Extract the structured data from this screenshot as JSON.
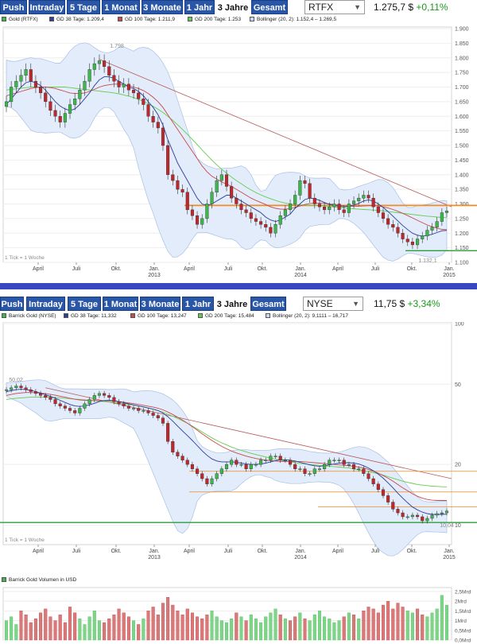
{
  "tabs": [
    "Push",
    "Intraday",
    "5 Tage",
    "1 Monat",
    "3 Monate",
    "1 Jahr",
    "3 Jahre",
    "Gesamt"
  ],
  "colors": {
    "up": "#3cb84a",
    "down": "#c0262c",
    "gd38": "#2c3e9e",
    "gd100": "#c94a4a",
    "gd200": "#66cc4f",
    "bollinger": "#c9d8f2",
    "orange": "#f08a24",
    "green": "#2e9e3e",
    "tab": "#2a56a8",
    "divider": "#3848c0"
  },
  "footer": "1 Tick = 1 Woche",
  "xaxis": {
    "months": [
      "April",
      "Juli",
      "Okt.",
      "Jan.",
      "April",
      "Juli",
      "Okt.",
      "Jan.",
      "April",
      "Juli",
      "Okt.",
      "Jan."
    ],
    "years": [
      "2013",
      "2014",
      "2015"
    ]
  },
  "gold": {
    "symbol": "RTFX",
    "price": "1.275,7 $",
    "change": "+0,11%",
    "legend": [
      "Gold (RTFX)",
      "GD 38 Tage: 1.209,4",
      "GD 100 Tage: 1.211,9",
      "GD 200 Tage: 1.253",
      "Bollinger (20, 2): 1.152,4 – 1.269,5"
    ],
    "high_label": "1.798",
    "low_label": "1.132,1",
    "chart_data": {
      "type": "candlestick",
      "ylim": [
        1100,
        1900
      ],
      "yticks": [
        "1.900",
        "1.850",
        "1.800",
        "1.750",
        "1.700",
        "1.650",
        "1.600",
        "1.550",
        "1.500",
        "1.450",
        "1.400",
        "1.350",
        "1.300",
        "1.250",
        "1.200",
        "1.150",
        "1.100"
      ],
      "series": [
        {
          "name": "Gold (RTFX)",
          "close": [
            1650,
            1700,
            1720,
            1740,
            1760,
            1720,
            1700,
            1680,
            1650,
            1620,
            1600,
            1580,
            1610,
            1640,
            1660,
            1690,
            1720,
            1760,
            1780,
            1790,
            1770,
            1740,
            1720,
            1700,
            1710,
            1690,
            1680,
            1660,
            1640,
            1600,
            1580,
            1560,
            1500,
            1400,
            1380,
            1350,
            1340,
            1280,
            1260,
            1230,
            1250,
            1300,
            1340,
            1380,
            1400,
            1360,
            1320,
            1300,
            1280,
            1270,
            1250,
            1240,
            1230,
            1220,
            1200,
            1230,
            1260,
            1280,
            1300,
            1330,
            1380,
            1370,
            1320,
            1300,
            1290,
            1280,
            1290,
            1300,
            1280,
            1270,
            1300,
            1310,
            1320,
            1330,
            1320,
            1290,
            1270,
            1250,
            1230,
            1220,
            1200,
            1180,
            1170,
            1160,
            1180,
            1190,
            1210,
            1220,
            1240,
            1270,
            1276
          ]
        }
      ]
    },
    "gd38": [
      1640,
      1660,
      1680,
      1700,
      1715,
      1720,
      1715,
      1705,
      1690,
      1670,
      1650,
      1635,
      1625,
      1620,
      1625,
      1640,
      1660,
      1680,
      1705,
      1725,
      1735,
      1735,
      1730,
      1720,
      1710,
      1700,
      1695,
      1685,
      1670,
      1650,
      1630,
      1605,
      1570,
      1520,
      1480,
      1440,
      1410,
      1380,
      1350,
      1320,
      1300,
      1295,
      1300,
      1310,
      1320,
      1330,
      1330,
      1320,
      1310,
      1300,
      1290,
      1280,
      1270,
      1255,
      1245,
      1240,
      1245,
      1255,
      1265,
      1285,
      1300,
      1315,
      1320,
      1318,
      1312,
      1305,
      1298,
      1295,
      1292,
      1290,
      1292,
      1296,
      1302,
      1310,
      1314,
      1310,
      1300,
      1288,
      1274,
      1258,
      1242,
      1226,
      1212,
      1200,
      1193,
      1190,
      1192,
      1196,
      1202,
      1208,
      1209.4
    ],
    "gd100": [
      1670,
      1675,
      1680,
      1685,
      1690,
      1695,
      1698,
      1700,
      1700,
      1698,
      1695,
      1690,
      1685,
      1680,
      1678,
      1678,
      1680,
      1685,
      1692,
      1700,
      1705,
      1708,
      1710,
      1710,
      1708,
      1705,
      1700,
      1695,
      1688,
      1678,
      1665,
      1650,
      1630,
      1605,
      1580,
      1555,
      1530,
      1505,
      1480,
      1455,
      1430,
      1410,
      1395,
      1385,
      1375,
      1368,
      1360,
      1350,
      1340,
      1330,
      1320,
      1312,
      1305,
      1298,
      1290,
      1285,
      1282,
      1282,
      1284,
      1288,
      1293,
      1298,
      1301,
      1303,
      1303,
      1302,
      1300,
      1298,
      1295,
      1293,
      1292,
      1292,
      1292,
      1293,
      1294,
      1294,
      1293,
      1290,
      1286,
      1281,
      1275,
      1268,
      1260,
      1252,
      1244,
      1236,
      1228,
      1222,
      1217,
      1213,
      1211.9
    ],
    "gd200": [
      1690,
      1692,
      1694,
      1696,
      1698,
      1700,
      1700,
      1700,
      1700,
      1700,
      1700,
      1700,
      1700,
      1698,
      1696,
      1694,
      1692,
      1690,
      1688,
      1686,
      1684,
      1682,
      1680,
      1677,
      1673,
      1669,
      1664,
      1658,
      1651,
      1643,
      1634,
      1624,
      1613,
      1600,
      1586,
      1571,
      1555,
      1538,
      1521,
      1503,
      1485,
      1467,
      1450,
      1434,
      1419,
      1405,
      1392,
      1380,
      1369,
      1358,
      1348,
      1339,
      1331,
      1324,
      1318,
      1312,
      1307,
      1303,
      1300,
      1298,
      1297,
      1296,
      1296,
      1295,
      1294,
      1293,
      1292,
      1290,
      1288,
      1286,
      1284,
      1283,
      1282,
      1281,
      1280,
      1279,
      1278,
      1276,
      1274,
      1272,
      1270,
      1268,
      1266,
      1264,
      1262,
      1260,
      1258,
      1257,
      1255,
      1254,
      1253
    ],
    "support_level": 1295,
    "low_level": 1140
  },
  "barrick": {
    "symbol": "NYSE",
    "price": "11,75 $",
    "change": "+3,34%",
    "legend": [
      "Barrick Gold (NYSE)",
      "GD 38 Tage: 11,332",
      "GD 100 Tage: 13,247",
      "GD 200 Tage: 15,484",
      "Bollinger (20, 2): 9,1111 – 16,717"
    ],
    "high_label": "50,02",
    "low_label": "10,04",
    "chart_data": {
      "type": "candlestick",
      "scale": "log",
      "ylim": [
        8,
        100
      ],
      "yticks": [
        "100",
        "50",
        "20",
        "10"
      ],
      "series": [
        {
          "name": "Barrick Gold (NYSE)",
          "close": [
            47,
            48,
            49,
            48,
            47,
            46,
            45,
            44,
            43,
            42,
            40,
            39,
            38,
            37,
            36,
            38,
            40,
            42,
            44,
            45,
            44,
            43,
            41,
            40,
            39,
            38,
            38,
            37,
            37,
            36,
            35,
            34,
            32,
            26,
            23,
            22,
            21,
            20,
            19,
            18,
            17,
            16,
            17,
            18,
            19,
            20,
            21,
            20,
            20,
            19,
            20,
            20,
            21,
            21,
            22,
            22,
            21,
            21,
            20,
            19,
            19,
            18,
            18,
            19,
            19,
            20,
            21,
            21,
            21,
            20,
            20,
            19,
            19,
            18,
            17,
            16,
            15,
            14,
            13,
            12,
            11.5,
            11,
            11,
            11.2,
            11,
            10.5,
            10.8,
            11.2,
            11.4,
            11.5,
            11.75
          ]
        }
      ]
    },
    "gd38": [
      46,
      46.5,
      47,
      47.2,
      47,
      46.6,
      46,
      45.2,
      44.4,
      43.5,
      42.6,
      41.6,
      40.6,
      39.7,
      39,
      38.8,
      39,
      39.5,
      40.2,
      41,
      41.5,
      41.6,
      41.4,
      41,
      40.5,
      40,
      39.5,
      39,
      38.6,
      38.1,
      37.6,
      37,
      36,
      34.5,
      32.8,
      31,
      29.3,
      27.8,
      26.3,
      24.8,
      23.4,
      22.2,
      21.3,
      20.8,
      20.6,
      20.6,
      20.6,
      20.5,
      20.3,
      20.1,
      20,
      20,
      20.1,
      20.3,
      20.6,
      20.9,
      21.1,
      21.1,
      21,
      20.8,
      20.5,
      20.2,
      19.9,
      19.7,
      19.6,
      19.7,
      19.9,
      20.1,
      20.3,
      20.4,
      20.4,
      20.3,
      20.1,
      19.7,
      19.2,
      18.6,
      17.9,
      17.1,
      16.2,
      15.3,
      14.4,
      13.6,
      12.9,
      12.3,
      11.9,
      11.6,
      11.4,
      11.3,
      11.3,
      11.3,
      11.33
    ],
    "gd100": [
      44,
      44.5,
      45,
      45.3,
      45.5,
      45.5,
      45.4,
      45.2,
      44.9,
      44.5,
      44.1,
      43.6,
      43.1,
      42.6,
      42.1,
      41.8,
      41.6,
      41.5,
      41.5,
      41.5,
      41.5,
      41.4,
      41.2,
      41,
      40.7,
      40.4,
      40.1,
      39.7,
      39.3,
      38.9,
      38.5,
      38,
      37.3,
      36.4,
      35.4,
      34.3,
      33.2,
      32,
      30.8,
      29.6,
      28.4,
      27.3,
      26.3,
      25.4,
      24.6,
      23.9,
      23.3,
      22.8,
      22.4,
      22,
      21.7,
      21.4,
      21.2,
      21,
      20.9,
      20.8,
      20.7,
      20.7,
      20.7,
      20.7,
      20.7,
      20.6,
      20.5,
      20.4,
      20.3,
      20.2,
      20.1,
      20,
      19.9,
      19.8,
      19.7,
      19.6,
      19.4,
      19.2,
      18.9,
      18.5,
      18.1,
      17.6,
      17.1,
      16.5,
      15.9,
      15.3,
      14.8,
      14.3,
      13.9,
      13.6,
      13.4,
      13.3,
      13.25,
      13.25,
      13.247
    ],
    "gd200": [
      42,
      42.3,
      42.6,
      42.8,
      43,
      43.1,
      43.2,
      43.2,
      43.2,
      43.1,
      43,
      42.8,
      42.6,
      42.4,
      42.2,
      42,
      41.8,
      41.6,
      41.4,
      41.2,
      41,
      40.8,
      40.6,
      40.3,
      40,
      39.7,
      39.4,
      39,
      38.6,
      38.1,
      37.6,
      37,
      36.3,
      35.5,
      34.7,
      33.8,
      32.9,
      32,
      31,
      30,
      29,
      28,
      27.1,
      26.3,
      25.6,
      25,
      24.4,
      23.9,
      23.5,
      23.1,
      22.7,
      22.4,
      22.1,
      21.8,
      21.5,
      21.2,
      21,
      20.8,
      20.6,
      20.4,
      20.2,
      20.1,
      20,
      19.9,
      19.8,
      19.7,
      19.6,
      19.5,
      19.4,
      19.3,
      19.2,
      19,
      18.8,
      18.6,
      18.4,
      18.2,
      18,
      17.7,
      17.4,
      17.1,
      16.8,
      16.5,
      16.3,
      16.1,
      15.9,
      15.8,
      15.7,
      15.6,
      15.55,
      15.5,
      15.484
    ],
    "level_orange_1": 18.5,
    "level_orange_2": 14.6,
    "level_orange_3": 12.3,
    "level_green": 10.3,
    "volume_legend": "Barrick Gold Volumen in USD",
    "volume_ticks": [
      "2,5Mrd",
      "2Mrd",
      "1,5Mrd",
      "1Mrd",
      "0,5Mrd",
      "0,0Mrd"
    ],
    "volume_ylim": [
      0,
      2.7
    ],
    "volume": [
      1.0,
      1.2,
      0.8,
      1.5,
      1.3,
      0.9,
      1.1,
      1.4,
      1.6,
      1.2,
      1.0,
      1.3,
      0.9,
      1.7,
      1.4,
      1.1,
      0.8,
      1.2,
      1.5,
      1.0,
      0.9,
      1.1,
      1.3,
      1.6,
      1.4,
      1.2,
      1.0,
      0.8,
      1.1,
      1.5,
      1.7,
      1.3,
      1.9,
      2.2,
      1.8,
      1.5,
      1.3,
      1.6,
      1.4,
      1.2,
      1.1,
      1.3,
      1.5,
      1.2,
      1.0,
      0.9,
      1.1,
      1.4,
      1.2,
      1.0,
      1.3,
      1.1,
      0.9,
      1.2,
      1.4,
      1.6,
      1.3,
      1.1,
      1.0,
      1.2,
      1.4,
      1.1,
      1.0,
      1.3,
      1.5,
      1.2,
      1.1,
      0.9,
      1.0,
      1.2,
      1.4,
      1.3,
      1.1,
      1.5,
      1.7,
      1.6,
      1.4,
      1.8,
      2.0,
      1.6,
      1.9,
      1.7,
      1.5,
      1.4,
      1.6,
      1.3,
      1.2,
      1.4,
      1.6,
      2.3,
      1.8
    ]
  }
}
